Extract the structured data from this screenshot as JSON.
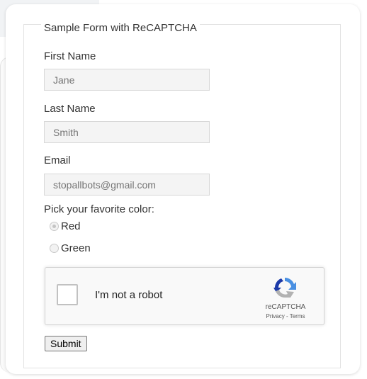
{
  "form": {
    "legend": "Sample Form with ReCAPTCHA",
    "first_name": {
      "label": "First Name",
      "placeholder": "Jane"
    },
    "last_name": {
      "label": "Last Name",
      "placeholder": "Smith"
    },
    "email": {
      "label": "Email",
      "placeholder": "stopallbots@gmail.com"
    },
    "color_question": "Pick your favorite color:",
    "color_options": [
      {
        "label": "Red",
        "selected": true
      },
      {
        "label": "Green",
        "selected": false
      }
    ],
    "submit_label": "Submit"
  },
  "recaptcha": {
    "label": "I'm not a robot",
    "brand": "reCAPTCHA",
    "privacy_link": "Privacy",
    "separator": " - ",
    "terms_link": "Terms",
    "icon": "recaptcha-logo-icon"
  },
  "colors": {
    "recaptcha_blue": "#4a90e2",
    "recaptcha_dark_blue": "#1c3aa9",
    "recaptcha_gray": "#b2b2b2"
  }
}
